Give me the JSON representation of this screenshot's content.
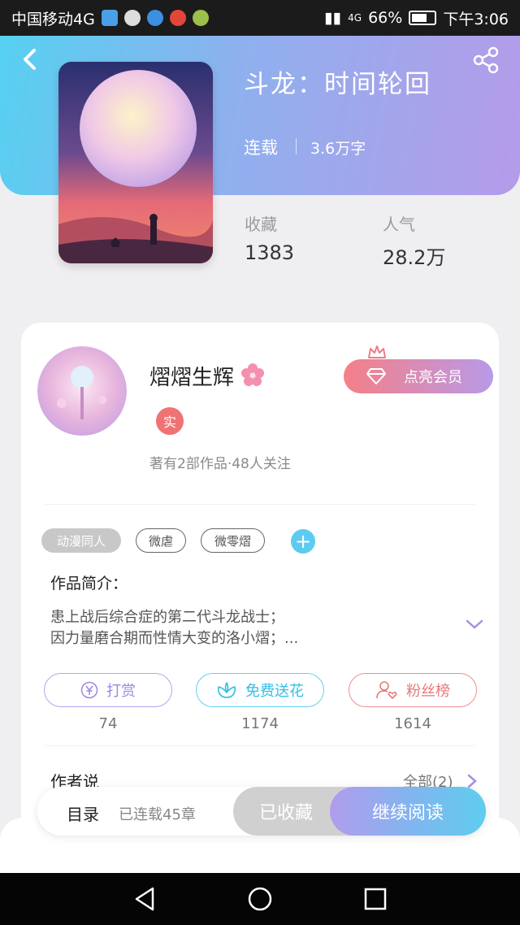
{
  "status_bar": {
    "carrier": "中国移动4G",
    "network": "4G",
    "battery": "66%",
    "time": "下午3:06"
  },
  "book": {
    "title": "斗龙：时间轮回",
    "status": "连载",
    "words": "3.6万字",
    "stats": [
      {
        "label": "收藏",
        "value": "1383"
      },
      {
        "label": "人气",
        "value": "28.2万"
      }
    ]
  },
  "author": {
    "name": "熠熠生辉",
    "badge": "实",
    "meta": "著有2部作品·48人关注",
    "vip_button": "点亮会员"
  },
  "tags": [
    "动漫同人",
    "微虐",
    "微零熠"
  ],
  "intro": {
    "heading": "作品简介：",
    "lines": [
      "患上战后综合症的第二代斗龙战士；",
      "因力量磨合期而性情大变的洛小熠；..."
    ]
  },
  "actions": [
    {
      "label": "打赏",
      "count": "74",
      "color": "#9f86e2"
    },
    {
      "label": "免费送花",
      "count": "1174",
      "color": "#33bde4"
    },
    {
      "label": "粉丝榜",
      "count": "1614",
      "color": "#e8797a"
    }
  ],
  "author_says": {
    "title": "作者说",
    "all": "全部(2)"
  },
  "bottom_bar": {
    "toc": "目录",
    "chapters": "已连载45章",
    "collected": "已收藏",
    "read": "继续阅读"
  },
  "colors": {
    "hero_gradient_start": "#56d1f1",
    "hero_gradient_end": "#b59be9",
    "accent_pink": "#f07374"
  }
}
